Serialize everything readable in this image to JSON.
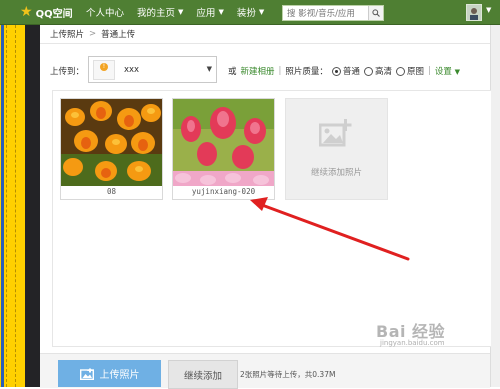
{
  "header": {
    "logo_text": "QQ空间",
    "nav": [
      {
        "label": "个人中心",
        "has_caret": false
      },
      {
        "label": "我的主页",
        "has_caret": true
      },
      {
        "label": "应用",
        "has_caret": true
      },
      {
        "label": "装扮",
        "has_caret": true
      }
    ],
    "caret_glyph": "▼",
    "search_placeholder": "搜 影视/音乐/应用"
  },
  "breadcrumb": [
    "上传照片",
    "普通上传"
  ],
  "breadcrumb_sep": ">",
  "upload_to": {
    "label": "上传到：",
    "album_name": "xxx"
  },
  "options": {
    "or": "或",
    "new_album": "新建相册",
    "divider": "|",
    "quality_label": "照片质量：",
    "quality_options": [
      {
        "label": "普通",
        "selected": true
      },
      {
        "label": "高清",
        "selected": false
      },
      {
        "label": "原图",
        "selected": false
      }
    ],
    "settings": "设置",
    "settings_caret": "▼"
  },
  "photos": [
    {
      "caption": "08",
      "icon": "tulip-orange-photo"
    },
    {
      "caption": "yujinxiang-020",
      "icon": "tulip-pink-photo"
    }
  ],
  "add_more_label": "继续添加照片",
  "bottom": {
    "upload_button": "上传照片",
    "continue_button": "继续添加",
    "status": "2张照片等待上传，共0.37M"
  },
  "watermark": {
    "text": "Bai 经验",
    "url": "jingyan.baidu.com"
  },
  "colors": {
    "topbar": "#4f7f33",
    "accent_green": "#3b8a2e",
    "upload_button": "#6fb0e4",
    "annotation_arrow": "#e02020"
  }
}
